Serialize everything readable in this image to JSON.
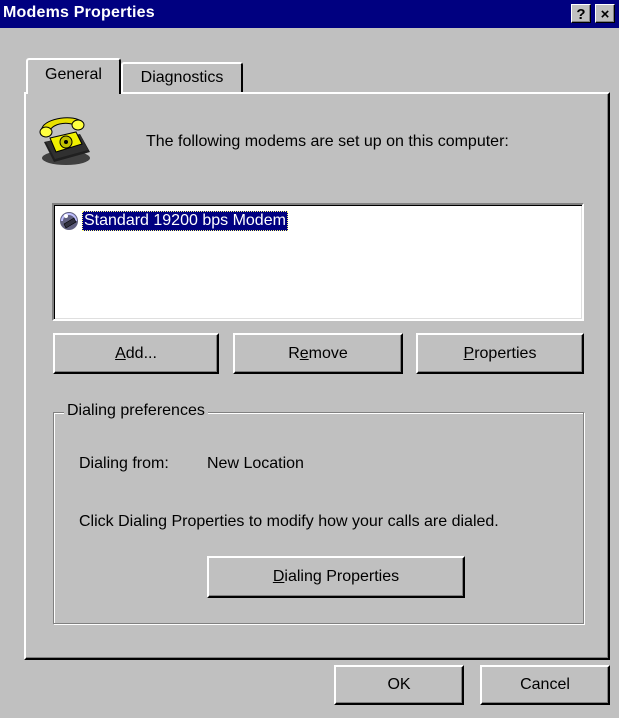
{
  "window": {
    "title": "Modems Properties",
    "help_button": "?",
    "close_button": "×"
  },
  "tabs": [
    {
      "label": "General",
      "selected": true
    },
    {
      "label": "Diagnostics",
      "selected": false
    }
  ],
  "general": {
    "intro_text": "The following modems are set up on this computer:",
    "modems": [
      {
        "label": "Standard 19200 bps Modem",
        "selected": true,
        "icon": "modem-icon"
      }
    ],
    "buttons": {
      "add_mn": "A",
      "add_rest": "dd...",
      "remove_pre": "R",
      "remove_mn": "e",
      "remove_rest": "move",
      "properties_mn": "P",
      "properties_rest": "roperties"
    },
    "dialing_preferences": {
      "group_label": "Dialing preferences",
      "dialing_from_label": "Dialing from:",
      "dialing_from_value": "New Location",
      "description": "Click Dialing Properties to modify how your calls are dialed.",
      "button_mn": "D",
      "button_rest": "ialing Properties"
    }
  },
  "footer": {
    "ok_label": "OK",
    "cancel_label": "Cancel"
  },
  "colors": {
    "face": "#c0c0c0",
    "title_bar": "#000080",
    "selection": "#000080"
  }
}
